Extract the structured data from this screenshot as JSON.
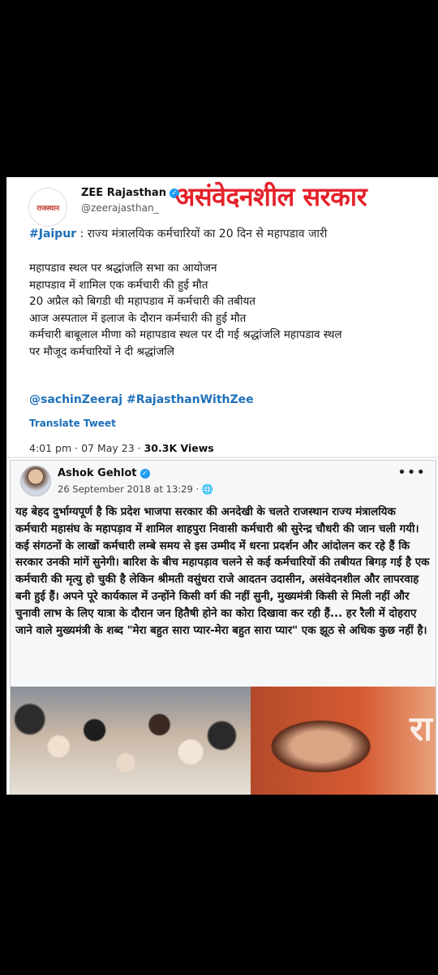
{
  "tweet": {
    "author_name": "ZEE Rajasthan",
    "handle": "@zeerajasthan_",
    "logo_text": "राजस्थान",
    "overlay_title": "असंवेदनशील सरकार",
    "headline_tag": "#Jaipur",
    "headline_text": " :  राज्य मंत्रालयिक कर्मचारियों का 20 दिन से महापडाव जारी",
    "lines": [
      "महापडाव स्थल पर श्रद्धांजलि सभा का आयोजन",
      "महापडाव में शामिल एक कर्मचारी की हुई मौत",
      "20 अप्रैल को बिगडी थी महापडाव में कर्मचारी की तबीयत",
      "आज अस्पताल में इलाज के दौरान कर्मचारी की हुई मौत",
      "कर्मचारी बाबूलाल मीणा को महापडाव स्थल पर दी गई श्रद्धांजलि महापडाव स्थल",
      "पर मौजूद कर्मचारियों ने दी श्रद्धांजलि"
    ],
    "hashtags": "@sachinZeeraj #RajasthanWithZee",
    "translate_label": "Translate Tweet",
    "time_date": "4:01 pm · 07 May 23 · ",
    "views": "30.3K Views"
  },
  "fb_post": {
    "author_name": "Ashok Gehlot",
    "date": "26 September 2018 at 13:29 · ",
    "more_label": "•••",
    "text": "यह बेहद दुर्भाग्यपूर्ण है कि प्रदेश भाजपा सरकार की अनदेखी के चलते राजस्थान राज्य मंत्रालयिक कर्मचारी महासंघ के महापड़ाव में शामिल शाहपुरा निवासी कर्मचारी श्री सुरेन्द्र चौधरी की जान चली गयी। कई संगठनों के लाखों कर्मचारी लम्बे समय से इस उम्मीद में धरना प्रदर्शन और आंदोलन कर रहे हैं कि सरकार उनकी मांगें सुनेगी। बारिश के बीच महापड़ाव चलने से कई कर्मचारियों की तबीयत बिगड़ गई है एक कर्मचारी की मृत्यु हो चुकी है लेकिन श्रीमती वसुंधरा राजे आदतन उदासीन, असंवेदनशील और लापरवाह बनी हुई हैं। अपने पूरे कार्यकाल में उन्होंने किसी वर्ग की नहीं सुनी, मुख्यमंत्री किसी से मिली नहीं और चुनावी लाभ के लिए यात्रा के दौरान जन हितैषी होने का कोरा दिखावा कर रही हैं... हर रैली में दोहराए जाने वाले मुख्यमंत्री के शब्द \"मेरा बहुत सारा प्यार-मेरा बहुत सारा प्यार\" एक झूठ से अधिक कुछ नहीं है।",
    "photo_text": "रा"
  }
}
